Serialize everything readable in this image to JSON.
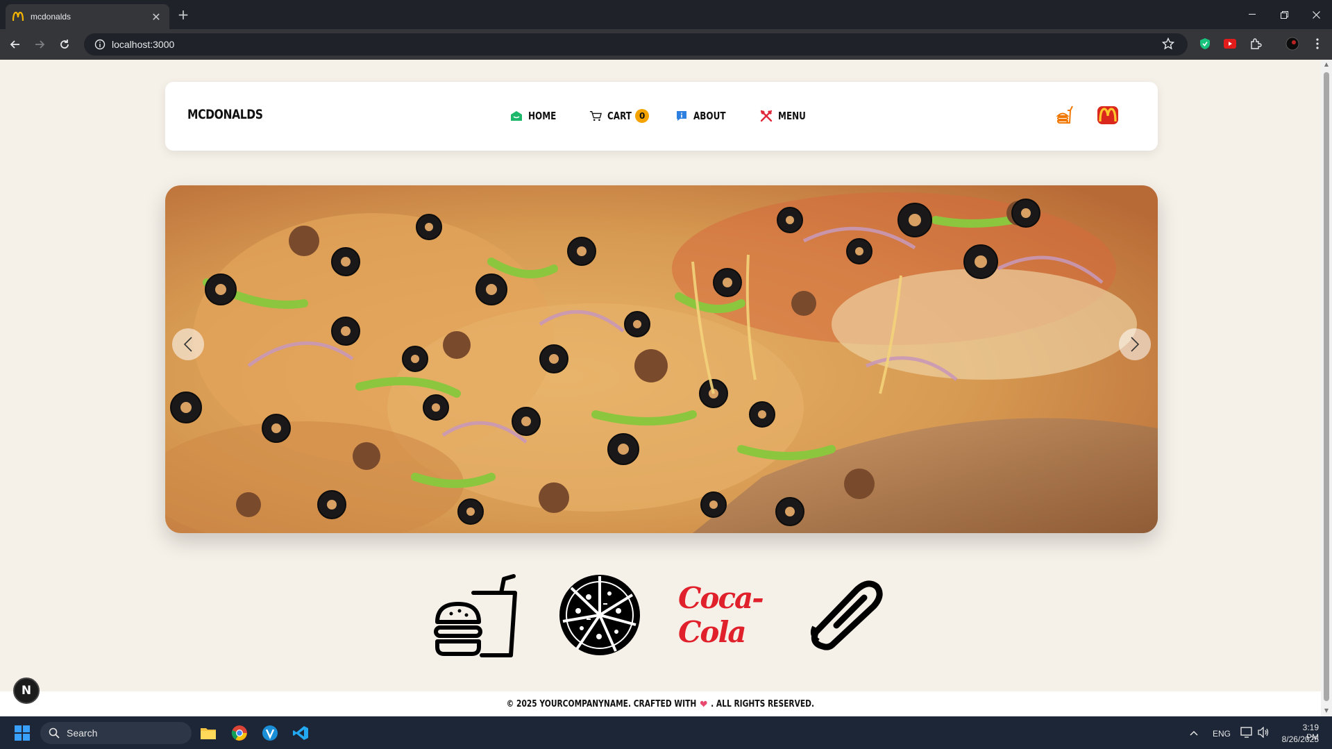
{
  "browser": {
    "tab_title": "mcdonalds",
    "url": "localhost:3000"
  },
  "header": {
    "brand": "MCDONALDS",
    "nav": [
      {
        "label": "HOME",
        "icon": "home-icon"
      },
      {
        "label": "CART",
        "icon": "cart-icon",
        "badge": "0"
      },
      {
        "label": "ABOUT",
        "icon": "info-icon"
      },
      {
        "label": "MENU",
        "icon": "utensils-icon"
      }
    ]
  },
  "hero": {
    "image": "pizza-image"
  },
  "categories": [
    {
      "name": "burger-drink-icon"
    },
    {
      "name": "pizza-icon"
    },
    {
      "name": "coca-cola-logo",
      "text": "Coca-Cola"
    },
    {
      "name": "hotdog-icon"
    }
  ],
  "footer": {
    "prefix": "© 2025 YOURCOMPANYNAME. CRAFTED WITH",
    "suffix": ". ALL RIGHTS RESERVED."
  },
  "dev_badge": "N",
  "taskbar": {
    "search_placeholder": "Search",
    "lang": "ENG",
    "time": "3:19 PM",
    "date": "8/26/2025"
  },
  "colors": {
    "page_bg": "#f5f0e8",
    "accent_orange": "#f5a300",
    "coke_red": "#e0202a",
    "home_green": "#1db86b",
    "info_blue": "#2d7fe0",
    "menu_red": "#e0283a"
  }
}
